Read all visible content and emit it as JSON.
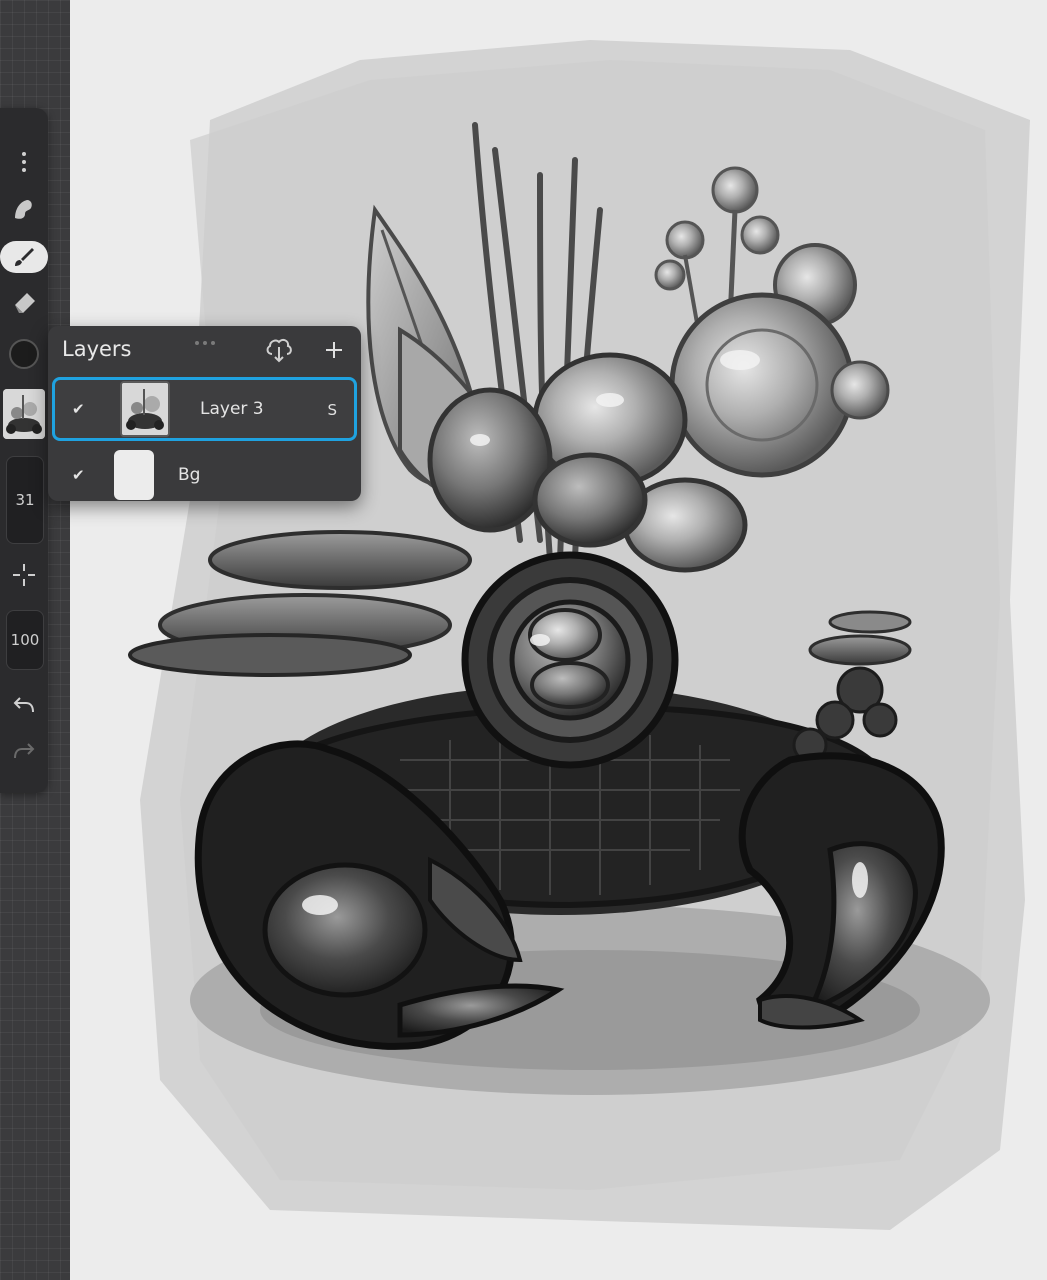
{
  "sidebar": {
    "size_value": "31",
    "opacity_value": "100",
    "color_swatch": "#1c1c1c"
  },
  "layers_panel": {
    "title": "Layers",
    "layers": [
      {
        "name": "Layer 3",
        "visible_check": "✔",
        "blend_mode": "S",
        "selected": true
      },
      {
        "name": "Bg",
        "visible_check": "✔",
        "blend_mode": "",
        "selected": false
      }
    ]
  },
  "colors": {
    "accent": "#1fa2e0",
    "panel_bg": "#3a3a3c",
    "sidebar_bg": "#2b2b2d"
  }
}
